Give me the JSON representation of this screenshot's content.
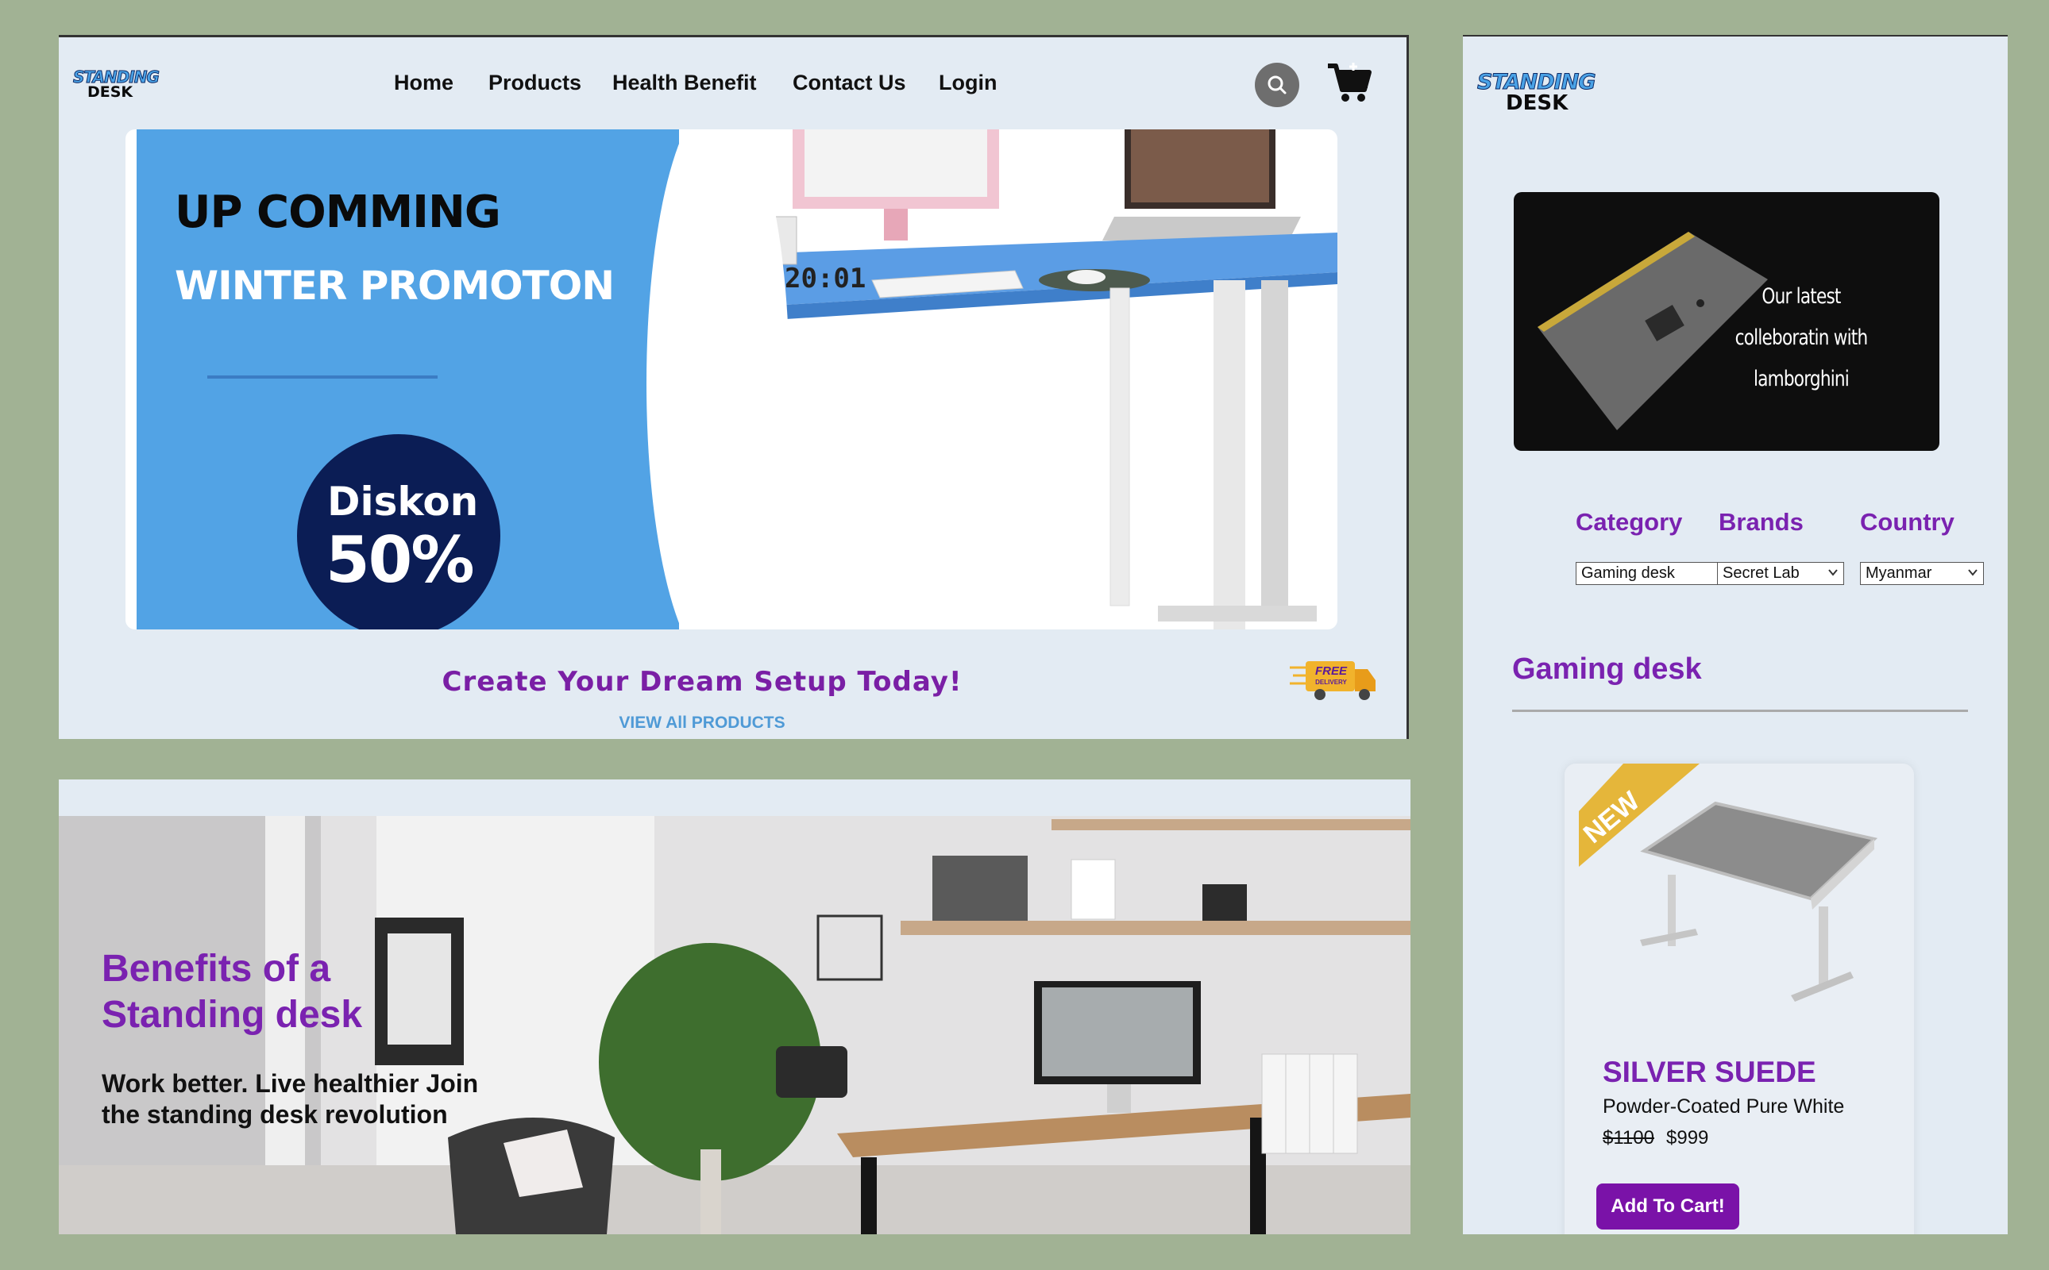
{
  "header": {
    "logo_top": "STANDING",
    "logo_bottom": "DESK",
    "nav": [
      "Home",
      "Products",
      "Health Benefit",
      "Contact Us",
      "Login"
    ]
  },
  "banner": {
    "headline": "UP COMMING",
    "subheadline": "WINTER PROMOTON",
    "discount_label": "Diskon",
    "discount_value": "50%",
    "clock": "20:01"
  },
  "cta": {
    "title": "Create Your Dream Setup Today!",
    "link": "VIEW All PRODUCTS",
    "badge_top": "FREE",
    "badge_bottom": "DELIVERY"
  },
  "benefits": {
    "title": "Benefits of a Standing desk",
    "subtitle": "Work better. Live healthier Join the standing desk revolution"
  },
  "sidebar": {
    "logo_top": "STANDING",
    "logo_bottom": "DESK",
    "collab_text": "Our latest colleboratin with lamborghini",
    "filters": [
      {
        "label": "Category",
        "value": "Gaming desk"
      },
      {
        "label": "Brands",
        "value": "Secret Lab"
      },
      {
        "label": "Country",
        "value": "Myanmar"
      }
    ],
    "section_title": "Gaming desk",
    "product": {
      "ribbon": "NEW",
      "name": "SILVER SUEDE",
      "description": "Powder-Coated Pure White",
      "old_price": "$1100",
      "price": "$999",
      "button": "Add To Cart!"
    }
  },
  "colors": {
    "background": "#a1b294",
    "panel": "#e3ebf3",
    "accent_purple": "#7a22b0",
    "banner_blue": "#52a3e5",
    "link_blue": "#4f9ad6",
    "button": "#7a12a8"
  },
  "icons": [
    "search-icon",
    "cart-icon",
    "truck-icon",
    "chevron-down-icon"
  ]
}
